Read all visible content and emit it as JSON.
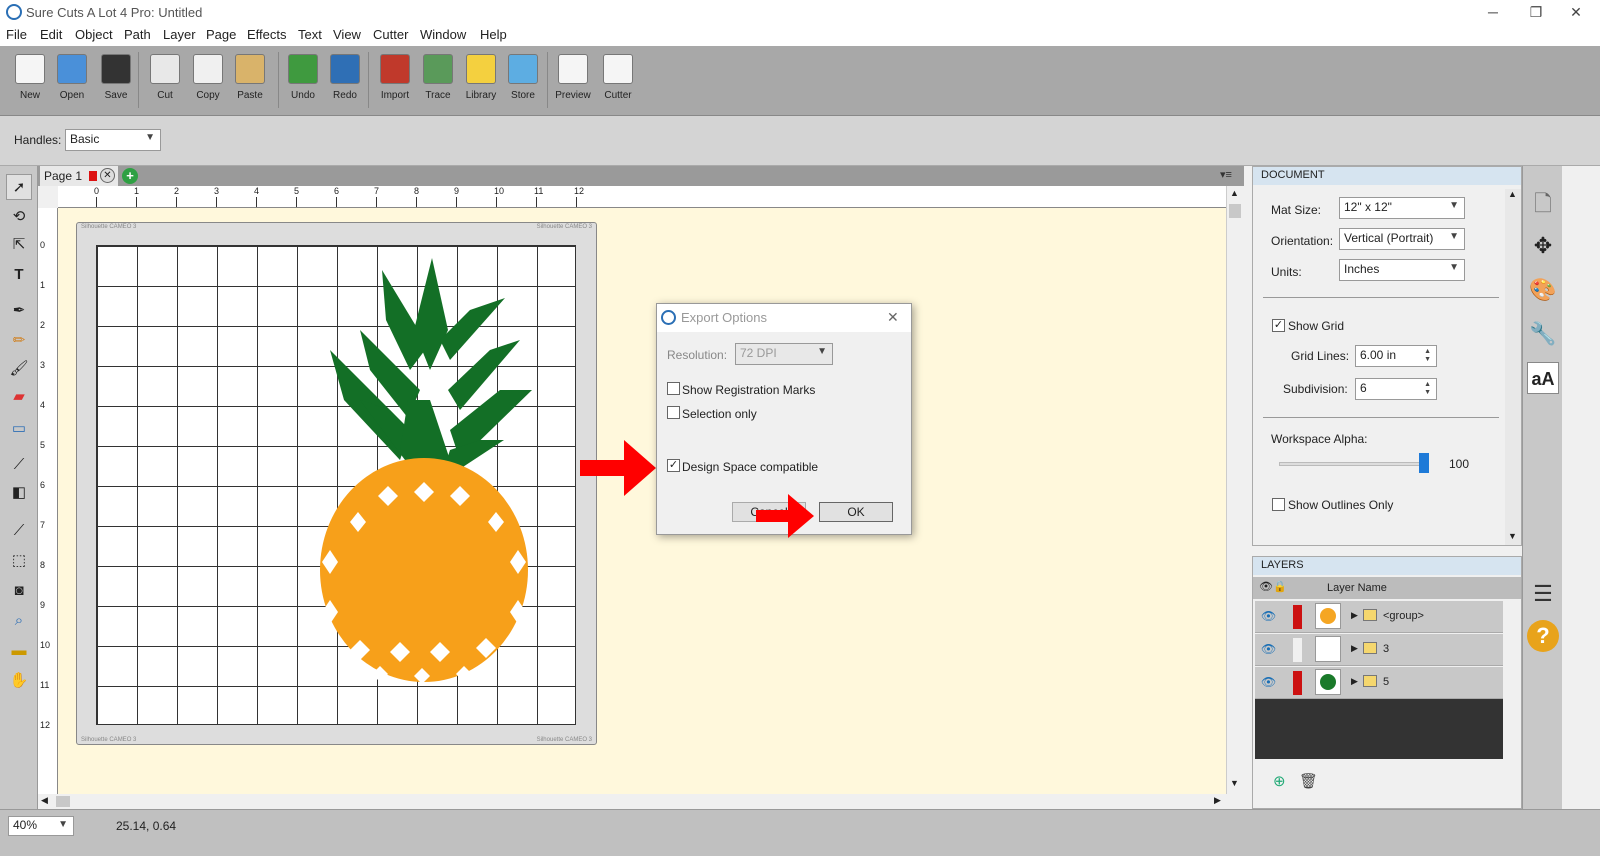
{
  "window": {
    "title": "Sure Cuts A Lot 4 Pro: Untitled",
    "min": "─",
    "restore": "❐",
    "close": "✕"
  },
  "menu": [
    "File",
    "Edit",
    "Object",
    "Path",
    "Layer",
    "Page",
    "Effects",
    "Text",
    "View",
    "Cutter",
    "Window",
    "Help"
  ],
  "toolbar": [
    {
      "label": "New",
      "icon": "new-icon",
      "color": "#f5f5f5"
    },
    {
      "label": "Open",
      "icon": "open-icon",
      "color": "#4a90d9"
    },
    {
      "label": "Save",
      "icon": "save-icon",
      "color": "#333333"
    },
    {
      "label": "Cut",
      "icon": "cut-icon",
      "color": "#e8e8e8"
    },
    {
      "label": "Copy",
      "icon": "copy-icon",
      "color": "#f0f0f0"
    },
    {
      "label": "Paste",
      "icon": "paste-icon",
      "color": "#d9b36a"
    },
    {
      "label": "Undo",
      "icon": "undo-icon",
      "color": "#3f9a3f"
    },
    {
      "label": "Redo",
      "icon": "redo-icon",
      "color": "#2f6fb5"
    },
    {
      "label": "Import",
      "icon": "import-svg-icon",
      "color": "#c0392b"
    },
    {
      "label": "Trace",
      "icon": "trace-icon",
      "color": "#5a9a5a"
    },
    {
      "label": "Library",
      "icon": "library-icon",
      "color": "#f4d03f"
    },
    {
      "label": "Store",
      "icon": "store-icon",
      "color": "#5dade2"
    },
    {
      "label": "Preview",
      "icon": "preview-icon",
      "color": "#f5f5f5"
    },
    {
      "label": "Cutter",
      "icon": "cutter-icon",
      "color": "#f5f5f5"
    }
  ],
  "options": {
    "handles_label": "Handles:",
    "handles_value": "Basic"
  },
  "page_tab": {
    "label": "Page 1"
  },
  "ruler_top": [
    "0",
    "1",
    "2",
    "3",
    "4",
    "5",
    "6",
    "7",
    "8",
    "9",
    "10",
    "11",
    "12"
  ],
  "ruler_left": [
    "0",
    "1",
    "2",
    "3",
    "4",
    "5",
    "6",
    "7",
    "8",
    "9",
    "10",
    "11",
    "12"
  ],
  "mat": {
    "brand": "Silhouette CAMEO 3"
  },
  "status": {
    "zoom": "40%",
    "coords": "25.14, 0.64"
  },
  "document": {
    "header": "DOCUMENT",
    "mat_size_label": "Mat Size:",
    "mat_size": "12\" x 12\"",
    "orientation_label": "Orientation:",
    "orientation": "Vertical (Portrait)",
    "units_label": "Units:",
    "units": "Inches",
    "show_grid": "Show Grid",
    "grid_lines_label": "Grid Lines:",
    "grid_lines": "6.00 in",
    "subdivision_label": "Subdivision:",
    "subdivision": "6",
    "alpha_label": "Workspace Alpha:",
    "alpha": "100",
    "outlines": "Show Outlines Only"
  },
  "layers": {
    "header": "LAYERS",
    "col": "Layer Name",
    "rows": [
      {
        "name": "<group>",
        "color": "#cc1111",
        "thumb": "#f5a623"
      },
      {
        "name": "3",
        "color": "#f0f0f0",
        "thumb": "#ffffff"
      },
      {
        "name": "5",
        "color": "#cc1111",
        "thumb": "#1a7a2a"
      }
    ]
  },
  "dialog": {
    "title": "Export Options",
    "resolution_label": "Resolution:",
    "resolution": "72 DPI",
    "reg_marks": "Show Registration Marks",
    "selection_only": "Selection only",
    "design_space": "Design Space compatible",
    "cancel": "Cancel",
    "ok": "OK"
  },
  "colors": {
    "pineapple_body": "#f7a01a",
    "pineapple_leaves": "#136f26",
    "arrow": "#ff0000"
  }
}
